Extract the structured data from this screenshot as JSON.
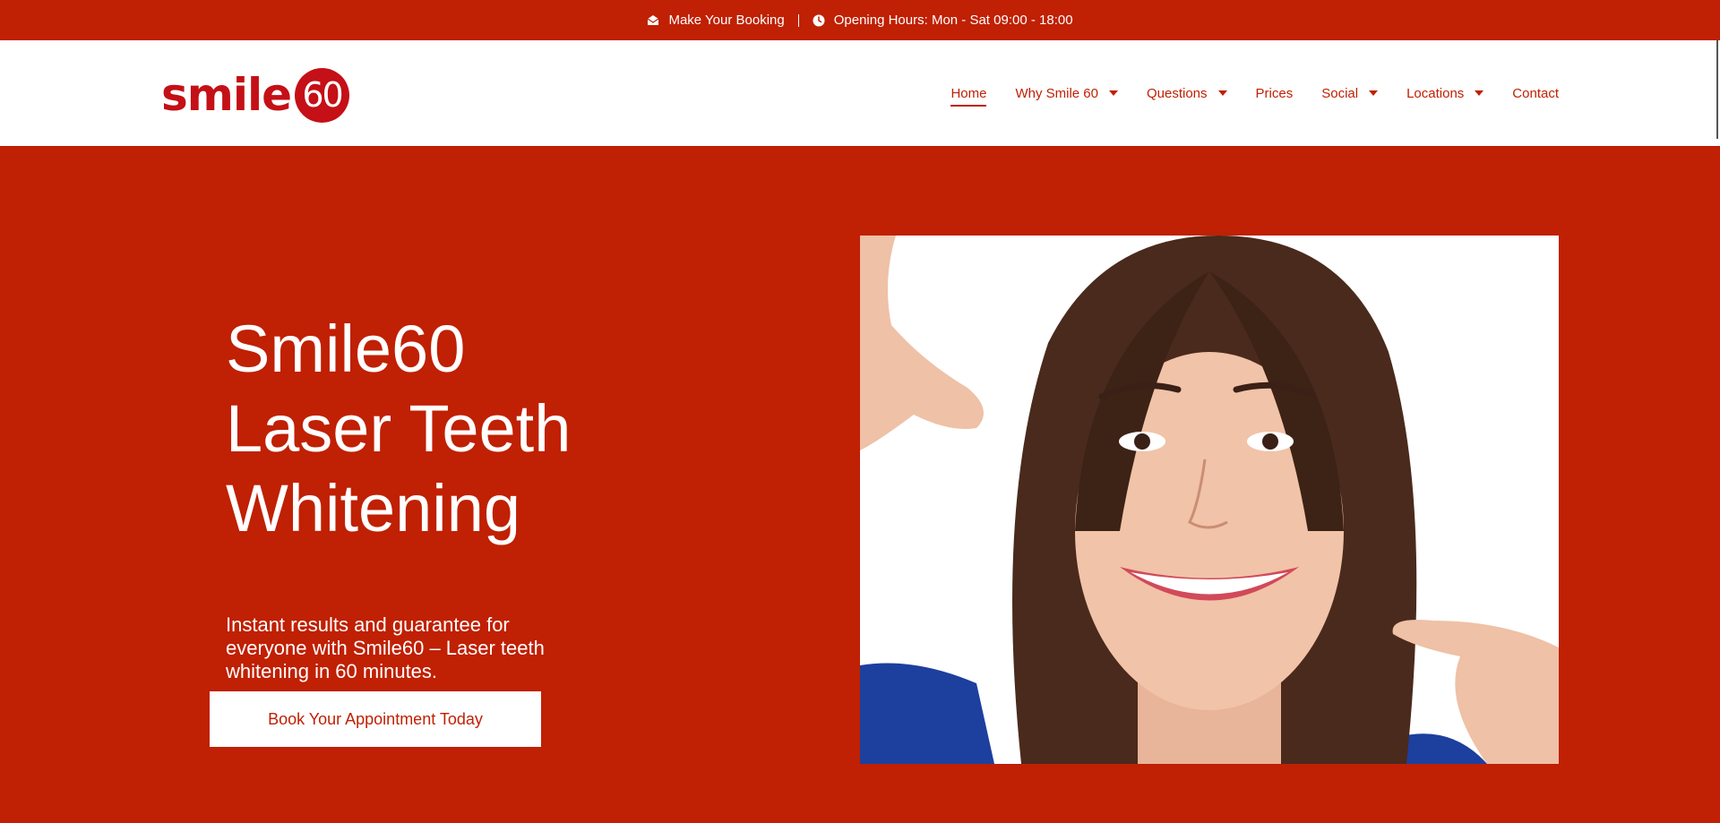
{
  "topbar": {
    "booking_label": "Make Your Booking",
    "hours_label": "Opening Hours: Mon - Sat 09:00 - 18:00",
    "booking_icon": "envelope-icon",
    "hours_icon": "clock-icon"
  },
  "logo": {
    "word": "smile",
    "number": "60"
  },
  "nav": {
    "items": [
      {
        "label": "Home",
        "active": true,
        "dropdown": false
      },
      {
        "label": "Why Smile 60",
        "dropdown": true
      },
      {
        "label": "Questions",
        "dropdown": true
      },
      {
        "label": "Prices",
        "dropdown": false
      },
      {
        "label": "Social",
        "dropdown": true
      },
      {
        "label": "Locations",
        "dropdown": true
      },
      {
        "label": "Contact",
        "dropdown": false
      }
    ]
  },
  "hero": {
    "title_line1": "Smile60",
    "title_line2": "Laser Teeth",
    "title_line3": "Whitening",
    "subtitle": "Instant results and guarantee for everyone with Smile60 – Laser teeth whitening in 60 minutes.",
    "cta_label": "Book Your Appointment Today"
  },
  "colors": {
    "brand_red": "#c02003",
    "logo_red": "#c41016",
    "white": "#ffffff"
  }
}
